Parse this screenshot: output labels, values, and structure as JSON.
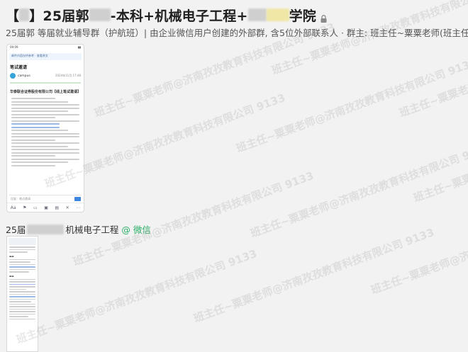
{
  "header": {
    "title_prefix": "【",
    "title_bracket_close": "】25届郭",
    "title_middle": "-本科+机械电子工程+",
    "title_suffix": "学院",
    "subtitle": "25届郭    等届就业辅导群（护航班）| 由企业微信用户创建的外部群, 含5位外部联系人 · 群主: 班主任~粟粟老师(班主任~"
  },
  "message1": {
    "email_subject": "笔试邀请",
    "sender_name": "campus",
    "sender_time": "2024年11月 17:48",
    "document_title": "华泰联合证券股份有限公司【线上笔试邀请】",
    "reply_placeholder": "回复：笔试邀请",
    "status_time": "09:09",
    "banner_text": "邮件内容仅供参考 · 查看原文"
  },
  "message2": {
    "sender_prefix": "25届",
    "sender_suffix": "机械电子工程",
    "sender_app": "@ 微信"
  },
  "watermark": {
    "text": "班主任~粟粟老师@济南孜孜教育科技有限公司 9133"
  },
  "icons": {
    "lock": "lock-icon",
    "toolbar": [
      "text-format-icon",
      "flag-icon",
      "attachment-icon",
      "image-icon",
      "folder-icon",
      "delete-icon",
      "more-icon"
    ]
  },
  "colors": {
    "wechat": "#2aae67",
    "background": "#f2f2f2"
  }
}
